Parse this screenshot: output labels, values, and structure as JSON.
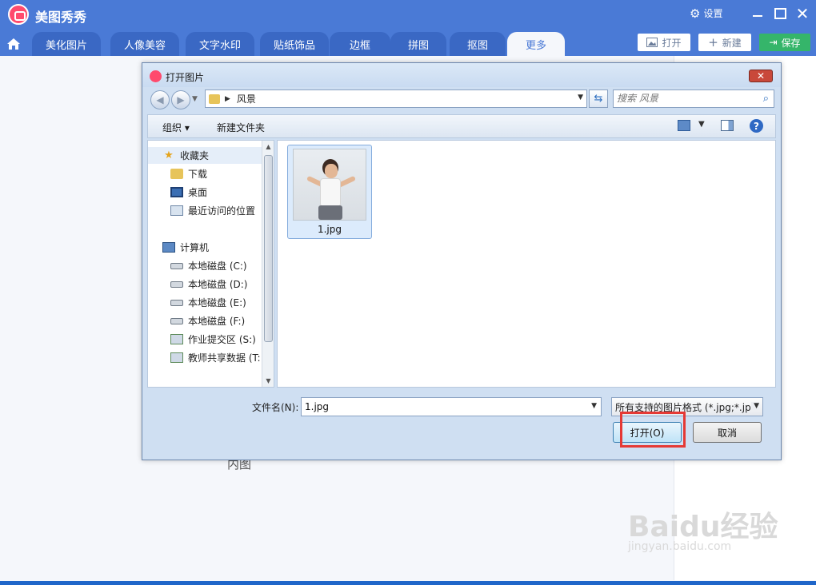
{
  "app": {
    "title": "美图秀秀",
    "settings_label": "设置",
    "close_label": "✕"
  },
  "tabs": [
    {
      "label": "美化图片"
    },
    {
      "label": "人像美容"
    },
    {
      "label": "文字水印"
    },
    {
      "label": "贴纸饰品"
    },
    {
      "label": "边框"
    },
    {
      "label": "拼图"
    },
    {
      "label": "抠图"
    },
    {
      "label": "更多",
      "active": true
    }
  ],
  "toolbar": {
    "open_label": "打开",
    "new_label": "新建",
    "save_label": "保存"
  },
  "background": {
    "partial_text": "内图"
  },
  "dialog": {
    "title": "打开图片",
    "close_label": "✕",
    "address": {
      "path": "风景"
    },
    "search": {
      "placeholder": "搜索 风景"
    },
    "commands": {
      "organize_label": "组织 ▾",
      "new_folder_label": "新建文件夹"
    },
    "nav": {
      "favorites": "收藏夹",
      "items": [
        {
          "label": "下载",
          "icon": "folder-icon"
        },
        {
          "label": "桌面",
          "icon": "desktop-icon"
        },
        {
          "label": "最近访问的位置",
          "icon": "recent-places-icon"
        }
      ],
      "computer": "计算机",
      "drives": [
        {
          "label": "本地磁盘 (C:)",
          "icon": "drive-c-icon"
        },
        {
          "label": "本地磁盘 (D:)",
          "icon": "drive-icon"
        },
        {
          "label": "本地磁盘 (E:)",
          "icon": "drive-icon"
        },
        {
          "label": "本地磁盘 (F:)",
          "icon": "drive-icon"
        },
        {
          "label": "作业提交区 (S:)",
          "icon": "network-drive-icon"
        },
        {
          "label": "教师共享数据 (T:",
          "icon": "network-drive-icon"
        }
      ]
    },
    "files": [
      {
        "name": "1.jpg",
        "selected": true
      }
    ],
    "filename": {
      "label": "文件名(N):",
      "value": "1.jpg"
    },
    "filetype": {
      "selected": "所有支持的图片格式 (*.jpg;*.jp"
    },
    "buttons": {
      "open_label": "打开(O)",
      "cancel_label": "取消"
    }
  },
  "watermark": {
    "brand": "Baidu经验",
    "url": "jingyan.baidu.com"
  },
  "colors": {
    "titlebar": "#4a7ad6",
    "save": "#35b56a",
    "highlight": "#e53935"
  }
}
